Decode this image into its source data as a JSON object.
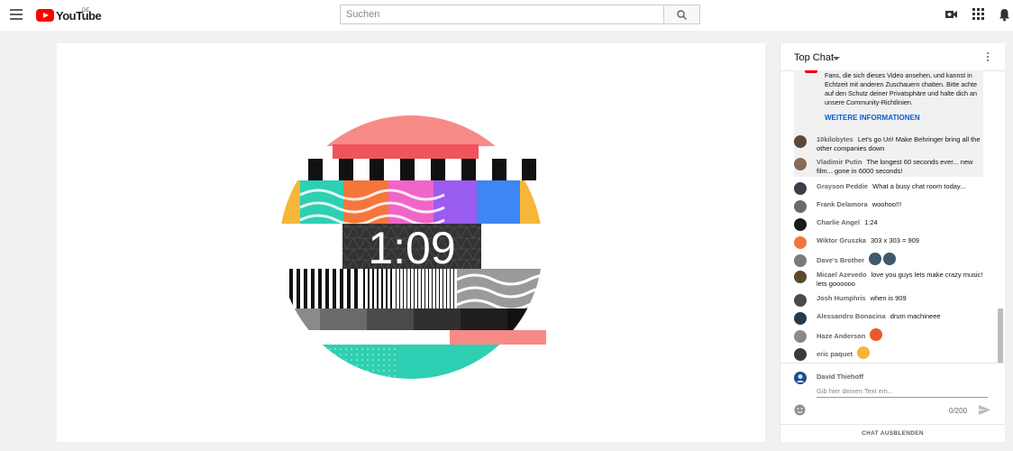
{
  "header": {
    "logo_text": "YouTube",
    "logo_region": "DE",
    "search_placeholder": "Suchen",
    "icons": [
      "menu-icon",
      "search-icon",
      "create-video-icon",
      "apps-icon",
      "notifications-icon"
    ]
  },
  "player": {
    "countdown": "1:09"
  },
  "chat": {
    "title": "Top Chat",
    "notice_text": "Fans, die sich dieses Video ansehen, und kannst in Echtzeit mit anderen Zuschauern chatten. Bitte achte auf den Schutz deiner Privatsphäre und halte dich an unsere Community-Richtlinien.",
    "notice_link": "WEITERE INFORMATIONEN",
    "messages": [
      {
        "author": "10kilobytes",
        "text": "Let's go Uri! Make Behringer bring all the other companies down",
        "avatar_color": "#5a4a3a"
      },
      {
        "author": "Vladimir Putin",
        "text": "The longest 60 seconds ever... new film... gone in 6000 seconds!",
        "avatar_color": "#8a6a5a"
      },
      {
        "author": "Grayson Peddie",
        "text": "What a busy chat room today...",
        "avatar_color": "#3a3f4a"
      },
      {
        "author": "Frank Delamora",
        "text": "woohoo!!!",
        "avatar_color": "#6a6a6a"
      },
      {
        "author": "Charlie Angel",
        "text": "1:24",
        "avatar_color": "#1a1a1a"
      },
      {
        "author": "Wiktor Gruszka",
        "text": "303 x 303 = 909",
        "avatar_color": "#f4763a"
      },
      {
        "author": "Dave's Brother",
        "text": "",
        "avatar_color": "#7a7a7a",
        "emojis": [
          "#3f5a6a",
          "#3f5a6a"
        ]
      },
      {
        "author": "Micael Azevedo",
        "text": "love you guys lets make crazy music! lets goooooo",
        "avatar_color": "#5a4a2a"
      },
      {
        "author": "Josh Humphris",
        "text": "when is 909",
        "avatar_color": "#4a4a4a"
      },
      {
        "author": "Alessandro Bonacina",
        "text": "drum machineee",
        "avatar_color": "#2a3a4a"
      },
      {
        "author": "Haze Anderson",
        "text": "",
        "avatar_color": "#8a8a8a",
        "emojis": [
          "#e85a2a"
        ]
      },
      {
        "author": "eric paquet",
        "text": "",
        "avatar_color": "#3a3a3a",
        "emojis": [
          "#f5b53a"
        ]
      }
    ],
    "current_user": "David Thiehoff",
    "input_placeholder": "Gib hier deinen Text ein...",
    "counter": "0/200",
    "hide_label": "CHAT AUSBLENDEN"
  }
}
